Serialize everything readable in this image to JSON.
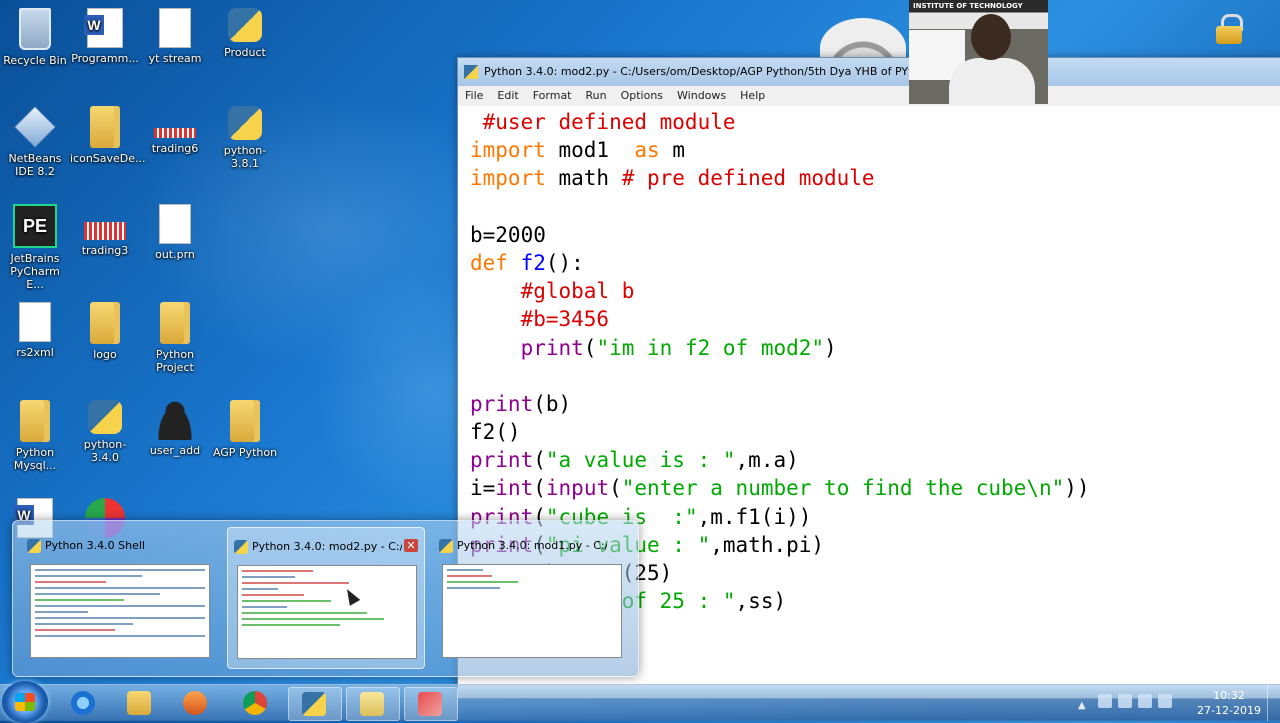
{
  "desktop": {
    "icons": [
      {
        "label": "Recycle Bin"
      },
      {
        "label": "Programm..."
      },
      {
        "label": "yt stream"
      },
      {
        "label": "Product"
      },
      {
        "label": "NetBeans IDE 8.2"
      },
      {
        "label": "iconSaveDe..."
      },
      {
        "label": "trading6"
      },
      {
        "label": "python-3.8.1"
      },
      {
        "label": "JetBrains PyCharm E..."
      },
      {
        "label": "trading3"
      },
      {
        "label": "out.prn"
      },
      {
        "label": "rs2xml"
      },
      {
        "label": "logo"
      },
      {
        "label": "Python Project"
      },
      {
        "label": "Python Mysql..."
      },
      {
        "label": "python-3.4.0"
      },
      {
        "label": "user_add"
      },
      {
        "label": "AGP Python"
      }
    ]
  },
  "webcam": {
    "banner": "INSTITUTE OF TECHNOLOGY"
  },
  "editor": {
    "title": "Python 3.4.0: mod2.py - C:/Users/om/Desktop/AGP Python/5th Dya YHB of PYthon/m",
    "menu": [
      "File",
      "Edit",
      "Format",
      "Run",
      "Options",
      "Windows",
      "Help"
    ],
    "code": [
      [
        {
          "t": " #user defined module",
          "c": "comment"
        }
      ],
      [
        {
          "t": "import",
          "c": "kw"
        },
        {
          "t": " mod1  ",
          "c": "plain"
        },
        {
          "t": "as",
          "c": "kw"
        },
        {
          "t": " m",
          "c": "plain"
        }
      ],
      [
        {
          "t": "import",
          "c": "kw"
        },
        {
          "t": " math ",
          "c": "plain"
        },
        {
          "t": "# pre defined module",
          "c": "comment"
        }
      ],
      [],
      [
        {
          "t": "b=2000",
          "c": "plain"
        }
      ],
      [
        {
          "t": "def",
          "c": "kw"
        },
        {
          "t": " ",
          "c": "plain"
        },
        {
          "t": "f2",
          "c": "def"
        },
        {
          "t": "():",
          "c": "plain"
        }
      ],
      [
        {
          "t": "    ",
          "c": "plain"
        },
        {
          "t": "#global b",
          "c": "comment"
        }
      ],
      [
        {
          "t": "    ",
          "c": "plain"
        },
        {
          "t": "#b=3456",
          "c": "comment"
        }
      ],
      [
        {
          "t": "    ",
          "c": "plain"
        },
        {
          "t": "print",
          "c": "builtin"
        },
        {
          "t": "(",
          "c": "plain"
        },
        {
          "t": "\"im in f2 of mod2\"",
          "c": "str"
        },
        {
          "t": ")",
          "c": "plain"
        }
      ],
      [],
      [
        {
          "t": "print",
          "c": "builtin"
        },
        {
          "t": "(b)",
          "c": "plain"
        }
      ],
      [
        {
          "t": "f2()",
          "c": "plain"
        }
      ],
      [
        {
          "t": "print",
          "c": "builtin"
        },
        {
          "t": "(",
          "c": "plain"
        },
        {
          "t": "\"a value is : \"",
          "c": "str"
        },
        {
          "t": ",m.a)",
          "c": "plain"
        }
      ],
      [
        {
          "t": "i=",
          "c": "plain"
        },
        {
          "t": "int",
          "c": "builtin"
        },
        {
          "t": "(",
          "c": "plain"
        },
        {
          "t": "input",
          "c": "builtin"
        },
        {
          "t": "(",
          "c": "plain"
        },
        {
          "t": "\"enter a number to find the cube\\n\"",
          "c": "str"
        },
        {
          "t": "))",
          "c": "plain"
        }
      ],
      [
        {
          "t": "print",
          "c": "builtin"
        },
        {
          "t": "(",
          "c": "plain"
        },
        {
          "t": "\"cube is  :\"",
          "c": "str"
        },
        {
          "t": ",m.f1(i))",
          "c": "plain"
        }
      ],
      [
        {
          "t": "print",
          "c": "builtin"
        },
        {
          "t": "(",
          "c": "plain"
        },
        {
          "t": "\"pi value : \"",
          "c": "str"
        },
        {
          "t": ",math.pi)",
          "c": "plain"
        }
      ],
      [
        {
          "t": "ss=math.sqrt(25)",
          "c": "plain"
        }
      ],
      [
        {
          "t": "print",
          "c": "builtin"
        },
        {
          "t": "(",
          "c": "plain"
        },
        {
          "t": "\"sqrt of 25 : \"",
          "c": "str"
        },
        {
          "t": ",ss)",
          "c": "plain"
        }
      ]
    ]
  },
  "preview": {
    "items": [
      {
        "label": "Python 3.4.0 Shell",
        "close": ""
      },
      {
        "label": "Python 3.4.0: mod2.py - C:/...",
        "close": "✕"
      },
      {
        "label": "Python 3.4.0: mod1.py - C:/User...",
        "close": ""
      }
    ]
  },
  "taskbar": {
    "buttons": [
      {
        "name": "internet-explorer"
      },
      {
        "name": "file-explorer"
      },
      {
        "name": "media-player"
      },
      {
        "name": "chrome"
      },
      {
        "name": "python-idle"
      },
      {
        "name": "folder"
      },
      {
        "name": "tool"
      }
    ],
    "clock": {
      "time": "10:32",
      "date": "27-12-2019"
    }
  }
}
